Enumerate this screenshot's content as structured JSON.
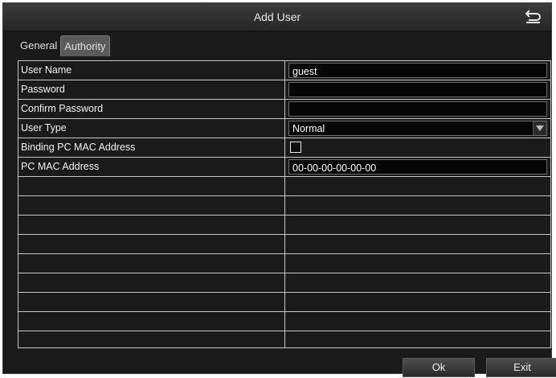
{
  "window": {
    "title": "Add User"
  },
  "tabs": [
    {
      "label": "General"
    },
    {
      "label": "Authority"
    }
  ],
  "form": {
    "user_name": {
      "label": "User Name",
      "value": "guest"
    },
    "password": {
      "label": "Password",
      "value": ""
    },
    "confirm_password": {
      "label": "Confirm Password",
      "value": ""
    },
    "user_type": {
      "label": "User Type",
      "value": "Normal"
    },
    "binding_mac": {
      "label": "Binding PC MAC Address",
      "checked": false
    },
    "pc_mac": {
      "label": "PC MAC Address",
      "value": "00-00-00-00-00-00"
    }
  },
  "buttons": {
    "ok": "Ok",
    "exit": "Exit"
  },
  "icons": {
    "back": "return-arrow-icon",
    "dropdown": "chevron-down-icon"
  }
}
